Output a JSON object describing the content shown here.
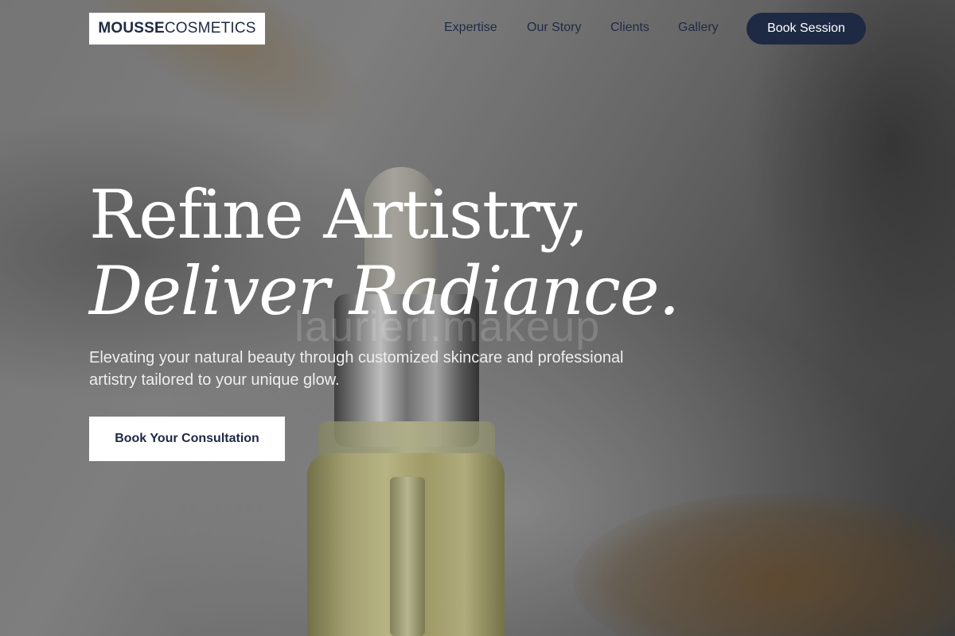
{
  "brand": {
    "logo_bold": "MOUSSE",
    "logo_light": "COSMETICS"
  },
  "nav": {
    "links": [
      "Expertise",
      "Our Story",
      "Clients",
      "Gallery"
    ],
    "cta": "Book Session"
  },
  "hero": {
    "title_line1": "Refine Artistry,",
    "title_line2": "Deliver Radiance.",
    "subtitle": "Elevating your natural beauty through customized skincare and professional artistry tailored to your unique glow.",
    "cta": "Book Your Consultation",
    "watermark": "laurieri.makeup"
  },
  "colors": {
    "navy": "#1e2a44",
    "white": "#ffffff"
  }
}
